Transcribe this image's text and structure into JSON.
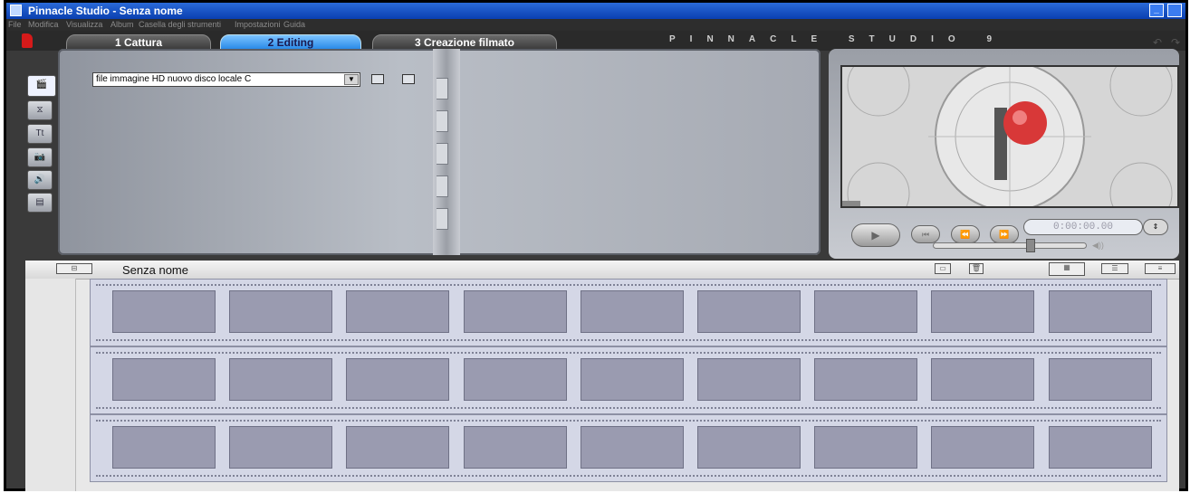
{
  "window": {
    "title": "Pinnacle Studio - Senza nome",
    "min_glyph": "_"
  },
  "menu": [
    "File",
    "Modifica",
    "Visualizza",
    "Album",
    "Casella degli strumenti",
    "Impostazioni",
    "Guida"
  ],
  "modes": {
    "tabs": [
      "1 Cattura",
      "2 Editing",
      "3 Creazione filmato"
    ],
    "active": "2 Editing",
    "brand": "PINNACLE STUDIO 9",
    "undo_glyph": "↶",
    "redo_glyph": "↷"
  },
  "album": {
    "side_tabs": [
      {
        "icon": "video-scenes-icon",
        "glyph": "🎬"
      },
      {
        "icon": "transitions-icon",
        "glyph": "⧖"
      },
      {
        "icon": "titles-icon",
        "glyph": "Tt"
      },
      {
        "icon": "still-images-icon",
        "glyph": "📷"
      },
      {
        "icon": "sound-effects-icon",
        "glyph": "🔊"
      },
      {
        "icon": "menus-icon",
        "glyph": "▤"
      }
    ],
    "source_value": "file immagine HD nuovo disco locale C",
    "select_arrow": "▼"
  },
  "player": {
    "timecode": "0:00:00.00",
    "play_glyph": "▶",
    "buttons": [
      "⏮",
      "⏪",
      "⏩"
    ],
    "spin_glyph": "⇕",
    "volume_glyph": "◀))"
  },
  "storyboard": {
    "title": "Senza nome",
    "icon_glyphs": {
      "movie_window": "⊟",
      "clipboard": "▭",
      "trash": "🗑",
      "storyboard_view": "▦",
      "timeline_view": "☰",
      "text_view": "≡"
    },
    "rows": 3,
    "cells_per_row": 9
  }
}
